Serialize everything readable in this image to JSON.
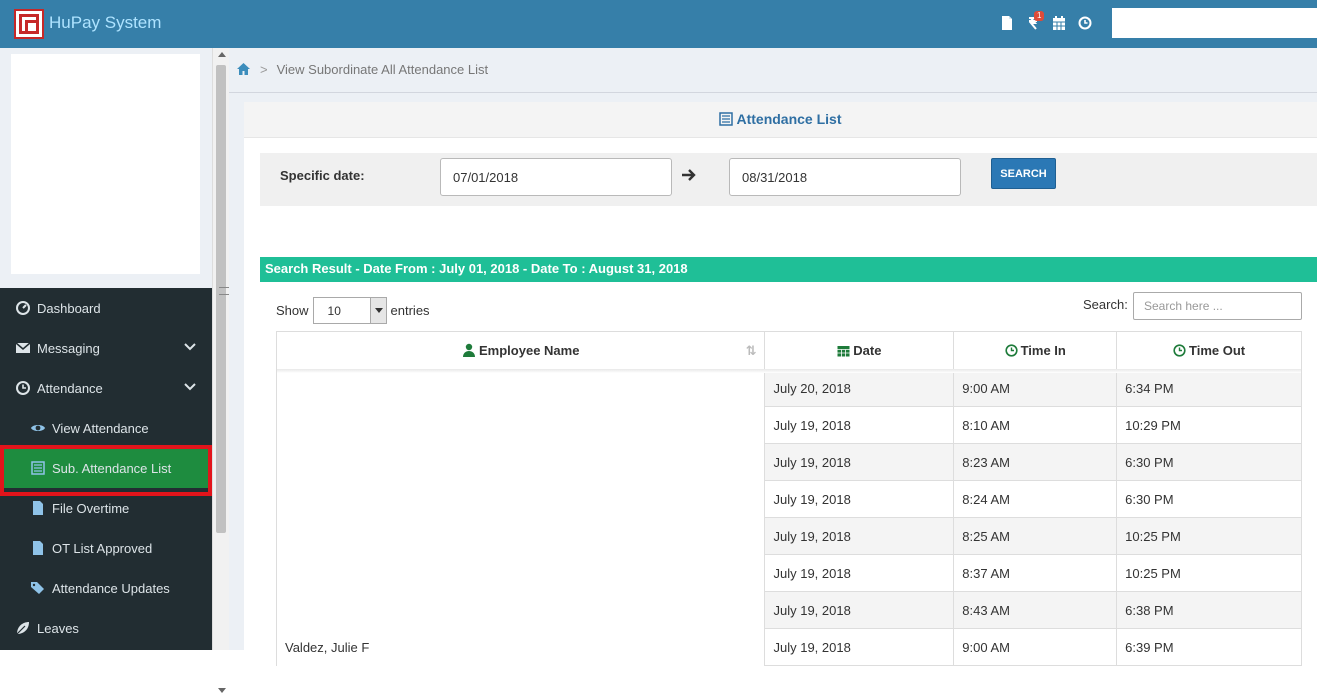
{
  "header": {
    "app_title": "HuPay System",
    "notification_count": "1",
    "icons": [
      "file-icon",
      "money-notification-icon",
      "calendar-icon",
      "clock-icon"
    ]
  },
  "breadcrumb": {
    "current": "View Subordinate All Attendance List"
  },
  "sidebar": {
    "items": [
      {
        "label": "Dashboard",
        "icon": "dashboard-icon"
      },
      {
        "label": "Messaging",
        "icon": "envelope-icon"
      },
      {
        "label": "Attendance",
        "icon": "clock-icon"
      },
      {
        "label": "View Attendance",
        "icon": "eye-icon"
      },
      {
        "label": "Sub. Attendance List",
        "icon": "list-icon"
      },
      {
        "label": "File Overtime",
        "icon": "file-icon"
      },
      {
        "label": "OT List Approved",
        "icon": "file-icon"
      },
      {
        "label": "Attendance Updates",
        "icon": "tags-icon"
      },
      {
        "label": "Leaves",
        "icon": "leaf-icon"
      }
    ]
  },
  "panel": {
    "title": "Attendance List"
  },
  "filter": {
    "label": "Specific date:",
    "date_from": "07/01/2018",
    "date_to": "08/31/2018",
    "search_label": "SEARCH"
  },
  "results": {
    "banner": "Search Result - Date From : July 01, 2018 - Date To : August 31, 2018",
    "show_label": "Show",
    "entries_value": "10",
    "entries_label": "entries",
    "search_label": "Search:",
    "search_placeholder": "Search here ..."
  },
  "table": {
    "columns": [
      "Employee Name",
      "Date",
      "Time In",
      "Time Out"
    ],
    "rows": [
      {
        "name": "",
        "date": "July 20, 2018",
        "time_in": "9:00 AM",
        "time_out": "6:34 PM"
      },
      {
        "name": "",
        "date": "July 19, 2018",
        "time_in": "8:10 AM",
        "time_out": "10:29 PM"
      },
      {
        "name": "",
        "date": "July 19, 2018",
        "time_in": "8:23 AM",
        "time_out": "6:30 PM"
      },
      {
        "name": "",
        "date": "July 19, 2018",
        "time_in": "8:24 AM",
        "time_out": "6:30 PM"
      },
      {
        "name": "",
        "date": "July 19, 2018",
        "time_in": "8:25 AM",
        "time_out": "10:25 PM"
      },
      {
        "name": "",
        "date": "July 19, 2018",
        "time_in": "8:37 AM",
        "time_out": "10:25 PM"
      },
      {
        "name": "",
        "date": "July 19, 2018",
        "time_in": "8:43 AM",
        "time_out": "6:38 PM"
      },
      {
        "name": "Valdez, Julie F",
        "date": "July 19, 2018",
        "time_in": "9:00 AM",
        "time_out": "6:39 PM"
      }
    ]
  }
}
